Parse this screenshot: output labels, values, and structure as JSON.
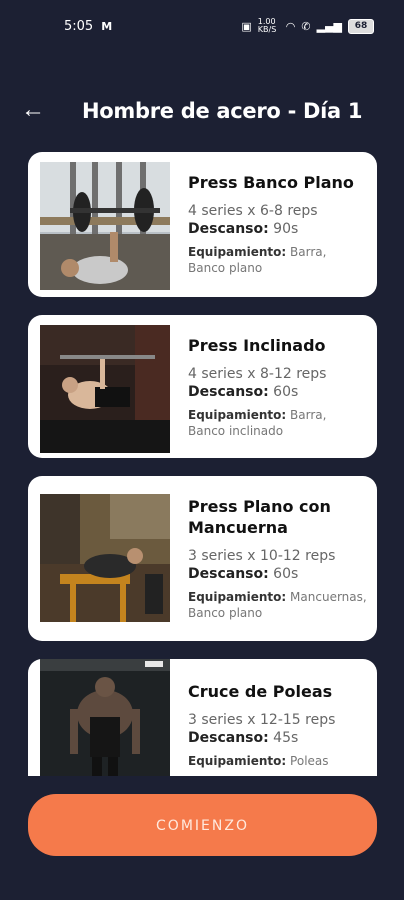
{
  "status_bar": {
    "time": "5:05",
    "carrier_icon": "M",
    "speed": "1.00 KB/S",
    "battery": "68"
  },
  "header": {
    "back_icon": "arrow-left-icon",
    "title": "Hombre de acero - Día 1"
  },
  "exercises": [
    {
      "name": "Press Banco Plano",
      "sets": "4 series x 6-8 reps",
      "rest_label": "Descanso:",
      "rest_value": "90s",
      "equip_label": "Equipamiento:",
      "equip_value": "Barra, Banco plano"
    },
    {
      "name": "Press Inclinado",
      "sets": "4 series x 8-12 reps",
      "rest_label": "Descanso:",
      "rest_value": "60s",
      "equip_label": "Equipamiento:",
      "equip_value": "Barra, Banco inclinado"
    },
    {
      "name": "Press Plano con Mancuerna",
      "sets": "3 series x 10-12 reps",
      "rest_label": "Descanso:",
      "rest_value": "60s",
      "equip_label": "Equipamiento:",
      "equip_value": "Mancuernas, Banco plano"
    },
    {
      "name": "Cruce de Poleas",
      "sets": "3 series x 12-15 reps",
      "rest_label": "Descanso:",
      "rest_value": "45s",
      "equip_label": "Equipamiento:",
      "equip_value": "Poleas"
    }
  ],
  "start_button": {
    "label": "COMIENZO",
    "color": "#f57a4b"
  },
  "colors": {
    "background": "#1c2033",
    "card": "#ffffff",
    "accent": "#f57a4b"
  }
}
